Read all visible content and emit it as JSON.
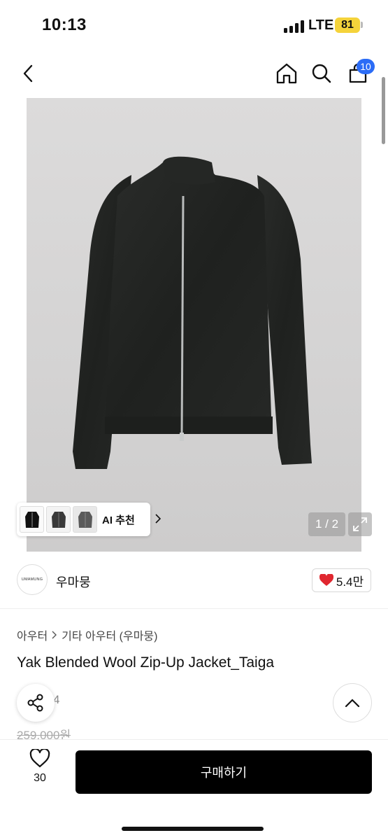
{
  "status": {
    "time": "10:13",
    "network": "LTE",
    "battery": "81"
  },
  "nav": {
    "cart_count": "10",
    "icons": [
      "back-arrow-icon",
      "home-icon",
      "search-icon",
      "cart-icon"
    ]
  },
  "gallery": {
    "page": "1 / 2",
    "reco_label": "AI 추천",
    "reco_thumbnails": 3
  },
  "shop": {
    "logo_text": "UMAMUNG",
    "name": "우마뭉",
    "likes": "5.4만"
  },
  "breadcrumb": {
    "category": "아우터",
    "subcategory": "기타 아우터 (우마뭉)"
  },
  "product": {
    "title": "Yak Blended Wool Zip-Up Jacket_Taiga",
    "partial_text": "4",
    "original_price": "259,000원"
  },
  "bottom": {
    "wish_count": "30",
    "buy_label": "구매하기"
  },
  "colors": {
    "cart_badge": "#2b6cf6",
    "buy_button": "#000000",
    "like_heart": "#e0272f",
    "battery": "#f5d33b"
  }
}
